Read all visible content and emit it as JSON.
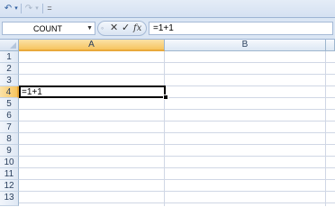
{
  "quick_access": {
    "undo_icon": "undo-icon",
    "undo_dropdown": "▾",
    "redo_icon": "redo-icon",
    "redo_dropdown": "▾",
    "customize": "="
  },
  "formula_bar": {
    "name_box": "COUNT",
    "cancel_symbol": "✕",
    "enter_symbol": "✓",
    "fx_symbol": "fx",
    "formula": "=1+1"
  },
  "columns": [
    "A",
    "B"
  ],
  "active_column": "A",
  "rows": [
    "1",
    "2",
    "3",
    "4",
    "5",
    "6",
    "7",
    "8",
    "9",
    "10",
    "11",
    "12",
    "13"
  ],
  "active_row": "4",
  "cells": {
    "A4": "=1+1"
  },
  "colors": {
    "header_active": "#f6c45f",
    "gridline": "#d0d7e5",
    "header_border": "#9eb6ce"
  }
}
